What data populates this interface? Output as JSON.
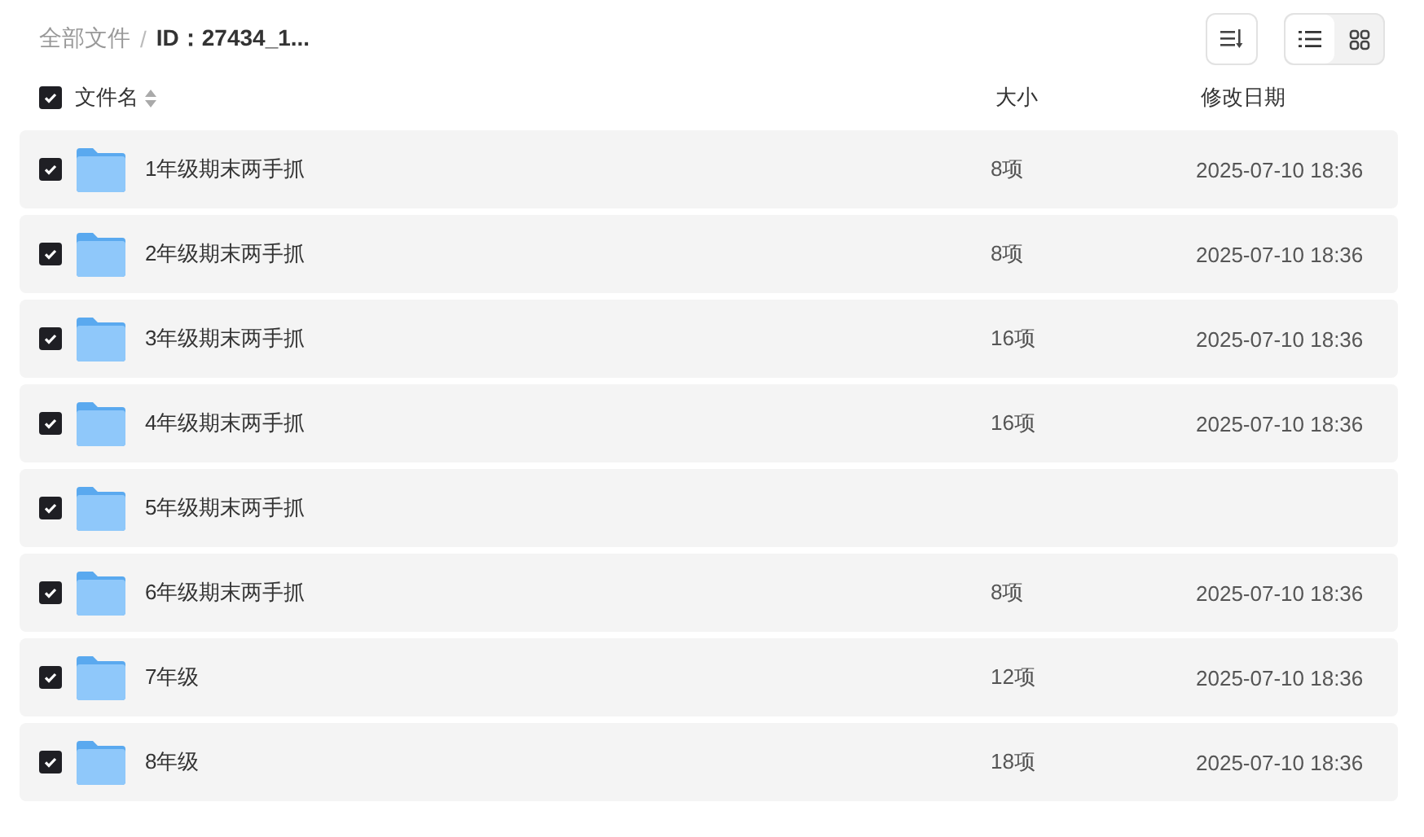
{
  "breadcrumb_separator": "/",
  "breadcrumb": [
    {
      "label": "全部文件",
      "current": false
    },
    {
      "label": "ID：27434_1...",
      "current": true
    }
  ],
  "view_toggle": [
    {
      "kind": "list",
      "selected": true
    },
    {
      "kind": "grid",
      "selected": false
    }
  ],
  "header": {
    "checked": true,
    "columns": [
      "文件名",
      "大小",
      "修改日期"
    ]
  },
  "rows": [
    {
      "checked": true,
      "name": "1年级期末两手抓",
      "size": "8项",
      "modified": "2025-07-10 18:36"
    },
    {
      "checked": true,
      "name": "2年级期末两手抓",
      "size": "8项",
      "modified": "2025-07-10 18:36"
    },
    {
      "checked": true,
      "name": "3年级期末两手抓",
      "size": "16项",
      "modified": "2025-07-10 18:36"
    },
    {
      "checked": true,
      "name": "4年级期末两手抓",
      "size": "16项",
      "modified": "2025-07-10 18:36"
    },
    {
      "checked": true,
      "name": "5年级期末两手抓"
    },
    {
      "checked": true,
      "name": "6年级期末两手抓",
      "size": "8项",
      "modified": "2025-07-10 18:36"
    },
    {
      "checked": true,
      "name": "7年级",
      "size": "12项",
      "modified": "2025-07-10 18:36"
    },
    {
      "checked": true,
      "name": "8年级",
      "size": "18项",
      "modified": "2025-07-10 18:36"
    }
  ]
}
